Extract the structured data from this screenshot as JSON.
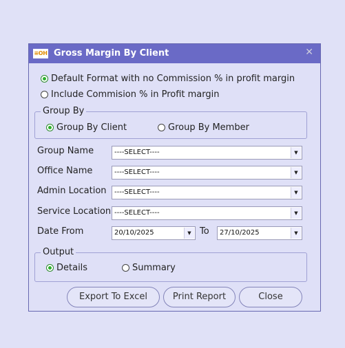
{
  "window": {
    "logo_text": "≡OH",
    "title": "Gross Margin By Client",
    "close_glyph": "✕"
  },
  "format_options": [
    {
      "label": "Default Format with no Commission % in profit margin",
      "selected": true
    },
    {
      "label": "Include Commision % in Profit margin",
      "selected": false
    }
  ],
  "group_by": {
    "legend": "Group By",
    "options": [
      {
        "label": "Group By Client",
        "selected": true
      },
      {
        "label": "Group By Member",
        "selected": false
      }
    ]
  },
  "fields": {
    "group_name": {
      "label": "Group Name",
      "value": "----SELECT----"
    },
    "office_name": {
      "label": "Office Name",
      "value": "----SELECT----"
    },
    "admin_location": {
      "label": "Admin Location",
      "value": "----SELECT----"
    },
    "service_location": {
      "label": "Service Location",
      "value": "----SELECT----"
    },
    "date_from": {
      "label": "Date From",
      "value": "20/10/2025"
    },
    "date_to": {
      "label": "To",
      "value": "27/10/2025"
    }
  },
  "output": {
    "legend": "Output",
    "options": [
      {
        "label": "Details",
        "selected": true
      },
      {
        "label": "Summary",
        "selected": false
      }
    ]
  },
  "buttons": {
    "export": "Export To Excel",
    "print": "Print Report",
    "close": "Close"
  },
  "icons": {
    "dropdown": "chevron-down-icon",
    "close": "close-icon"
  },
  "colors": {
    "titlebar": "#6a6ac6",
    "background": "#dfe0f7",
    "radio_selected": "#2bb02b"
  }
}
